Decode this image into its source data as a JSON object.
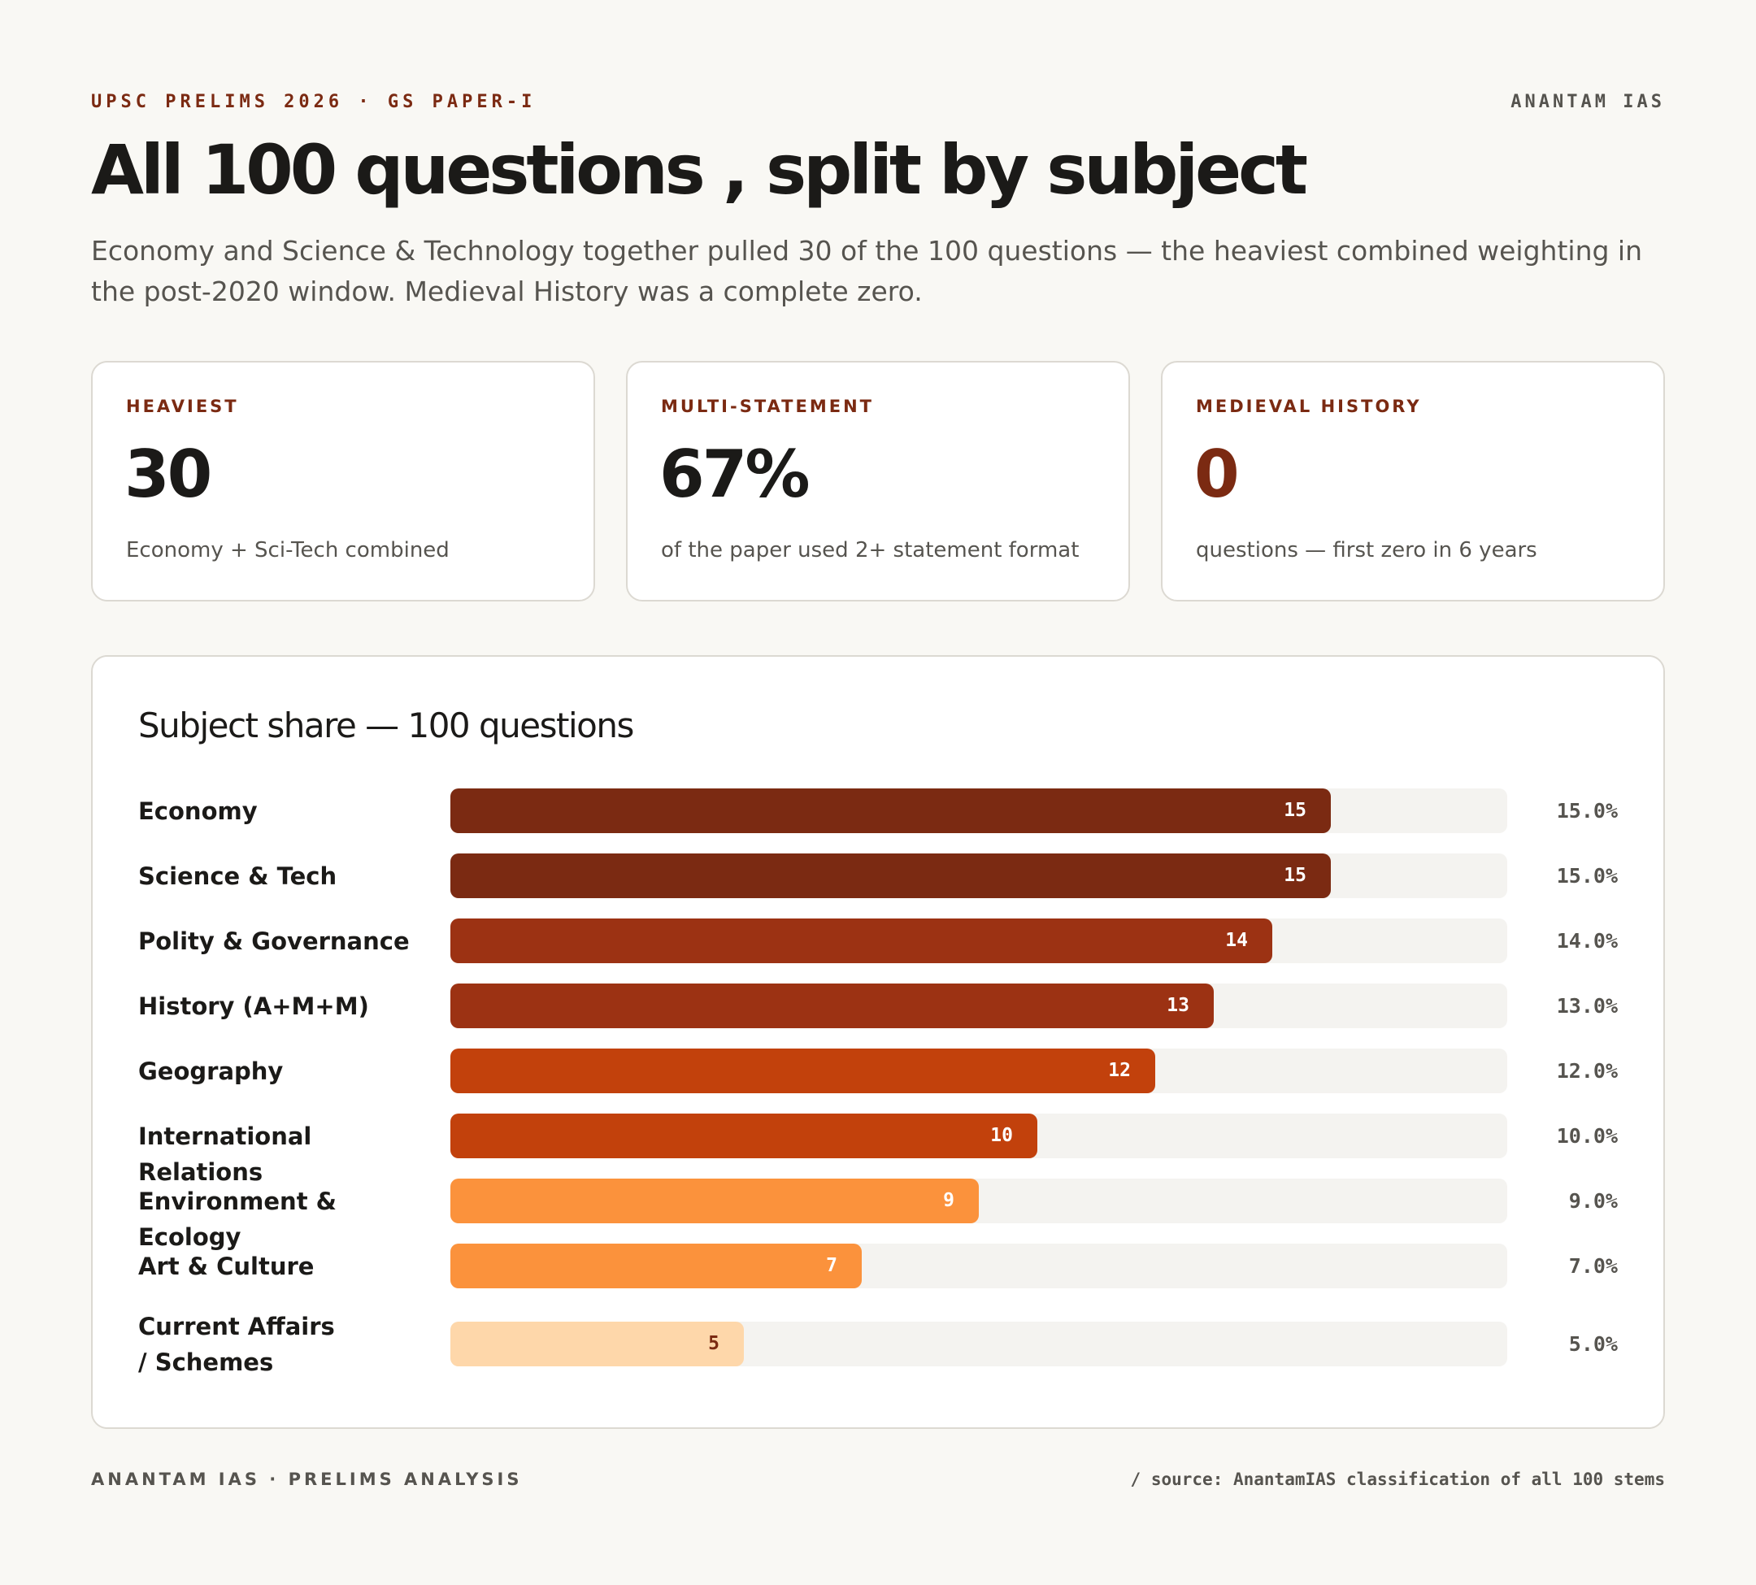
{
  "header": {
    "eyebrow": "UPSC PRELIMS 2026 · GS PAPER-I",
    "brand": "ANANTAM IAS",
    "title": "All 100 questions , split by subject",
    "subtitle": "Economy and Science & Technology together pulled 30 of the 100 questions — the heaviest combined weighting in the post-2020 window. Medieval History was a complete zero."
  },
  "stats": [
    {
      "label": "HEAVIEST",
      "value": "30",
      "note": "Economy + Sci-Tech combined"
    },
    {
      "label": "MULTI-STATEMENT",
      "value": "67%",
      "note": "of the paper used 2+ statement format"
    },
    {
      "label": "MEDIEVAL HISTORY",
      "value": "0",
      "note": "questions — first zero in 6 years"
    }
  ],
  "colors": {
    "brand_dark": "#7b2a12",
    "tier1": "#7b2a12",
    "tier2": "#9c3213",
    "tier3": "#c2410c",
    "tier4": "#fb923c",
    "tier5": "#fed7aa",
    "track": "#f4f3f0"
  },
  "chart_data": {
    "type": "bar",
    "orientation": "horizontal",
    "title": "Subject share — 100 questions",
    "xlim": [
      0,
      18
    ],
    "categories": [
      "Economy",
      "Science & Tech",
      "Polity & Governance",
      "History (A+M+M)",
      "Geography",
      "International Relations",
      "Environment & Ecology",
      "Art & Culture",
      "Current Affairs / Schemes"
    ],
    "values": [
      15,
      15,
      14,
      13,
      12,
      10,
      9,
      7,
      5
    ],
    "value_labels": [
      "15",
      "15",
      "14",
      "13",
      "12",
      "10",
      "9",
      "7",
      "5"
    ],
    "percent_labels": [
      "15.0%",
      "15.0%",
      "14.0%",
      "13.0%",
      "12.0%",
      "10.0%",
      "9.0%",
      "7.0%",
      "5.0%"
    ],
    "bar_colors": [
      "#7b2a12",
      "#7b2a12",
      "#9c3213",
      "#9c3213",
      "#c2410c",
      "#c2410c",
      "#fb923c",
      "#fb923c",
      "#fed7aa"
    ],
    "label_colors": [
      "#ffffff",
      "#ffffff",
      "#ffffff",
      "#ffffff",
      "#ffffff",
      "#ffffff",
      "#ffffff",
      "#ffffff",
      "#7b2a12"
    ]
  },
  "footer": {
    "left": "ANANTAM IAS · PRELIMS ANALYSIS",
    "right": "/ source: AnantamIAS classification of all 100 stems"
  }
}
